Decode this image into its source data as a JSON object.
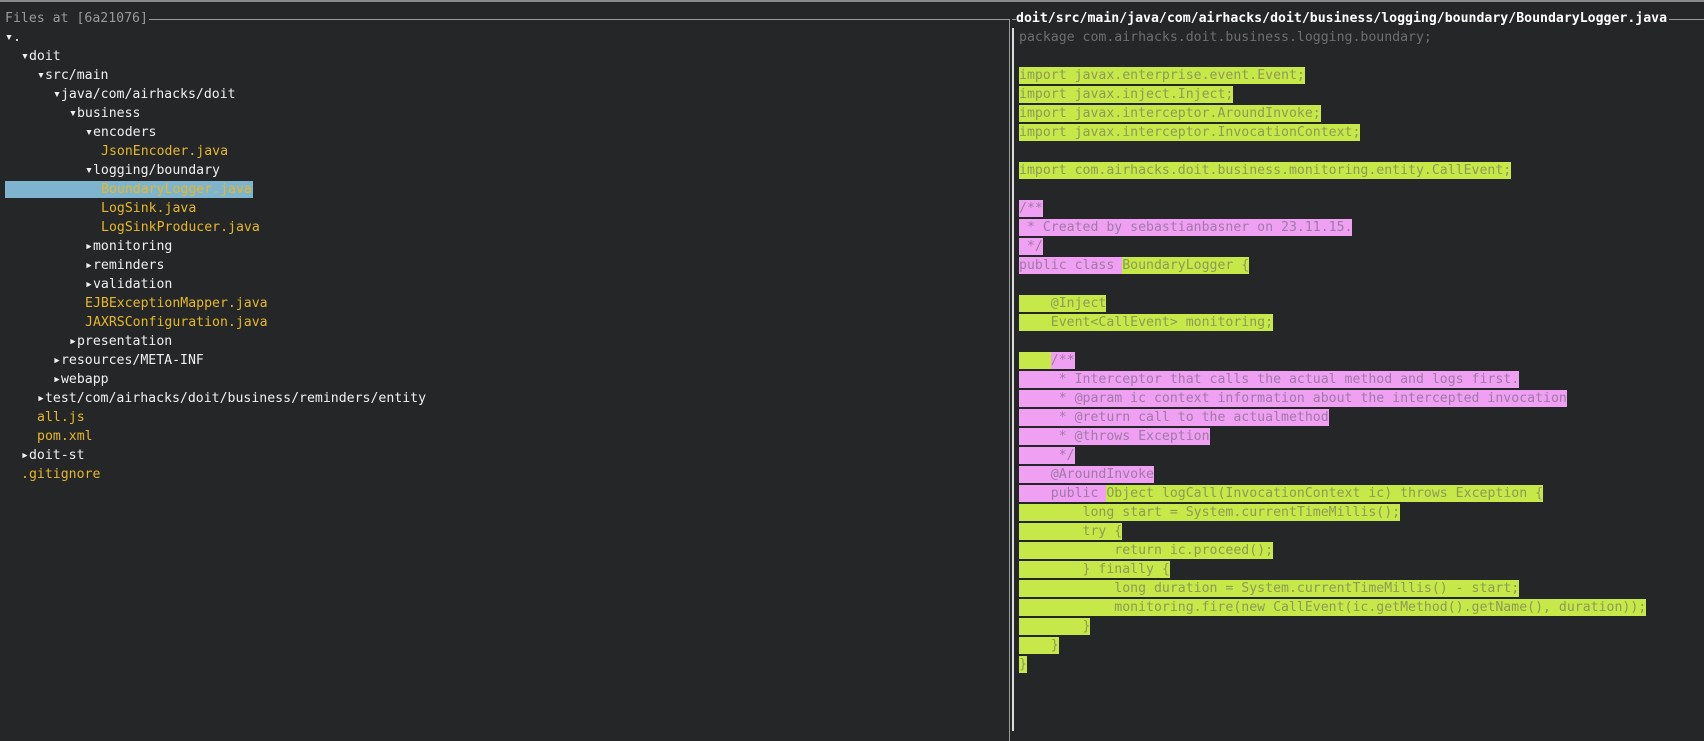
{
  "left_pane": {
    "title": "Files at [6a21076]",
    "tree": [
      {
        "label": "▾.",
        "kind": "dir",
        "depth": 0
      },
      {
        "label": "▾doit",
        "kind": "dir",
        "depth": 1
      },
      {
        "label": "▾src/main",
        "kind": "dir",
        "depth": 2
      },
      {
        "label": "▾java/com/airhacks/doit",
        "kind": "dir",
        "depth": 3
      },
      {
        "label": "▾business",
        "kind": "dir",
        "depth": 4
      },
      {
        "label": "▾encoders",
        "kind": "dir",
        "depth": 5
      },
      {
        "label": "JsonEncoder.java",
        "kind": "file",
        "depth": 6
      },
      {
        "label": "▾logging/boundary",
        "kind": "dir",
        "depth": 5
      },
      {
        "label": "BoundaryLogger.java",
        "kind": "file",
        "depth": 6,
        "selected": true
      },
      {
        "label": "LogSink.java",
        "kind": "file",
        "depth": 6
      },
      {
        "label": "LogSinkProducer.java",
        "kind": "file",
        "depth": 6
      },
      {
        "label": "▸monitoring",
        "kind": "dir",
        "depth": 5
      },
      {
        "label": "▸reminders",
        "kind": "dir",
        "depth": 5
      },
      {
        "label": "▸validation",
        "kind": "dir",
        "depth": 5
      },
      {
        "label": "EJBExceptionMapper.java",
        "kind": "file",
        "depth": 5
      },
      {
        "label": "JAXRSConfiguration.java",
        "kind": "file",
        "depth": 5
      },
      {
        "label": "▸presentation",
        "kind": "dir",
        "depth": 4
      },
      {
        "label": "▸resources/META-INF",
        "kind": "dir",
        "depth": 3
      },
      {
        "label": "▸webapp",
        "kind": "dir",
        "depth": 3
      },
      {
        "label": "▸test/com/airhacks/doit/business/reminders/entity",
        "kind": "dir",
        "depth": 2
      },
      {
        "label": "all.js",
        "kind": "file",
        "depth": 2
      },
      {
        "label": "pom.xml",
        "kind": "file",
        "depth": 2
      },
      {
        "label": "▸doit-st",
        "kind": "dir",
        "depth": 1
      },
      {
        "label": ".gitignore",
        "kind": "file",
        "depth": 1
      }
    ]
  },
  "right_pane": {
    "title": "doit/src/main/java/com/airhacks/doit/business/logging/boundary/BoundaryLogger.java",
    "lines": [
      [
        {
          "t": "package com.airhacks.doit.business.logging.boundary;",
          "c": "gray"
        }
      ],
      [],
      [
        {
          "t": "import ",
          "c": "g"
        },
        {
          "t": "javax.enterprise.event.Event;",
          "c": "g"
        }
      ],
      [
        {
          "t": "import javax.inject.Inject;",
          "c": "g"
        }
      ],
      [
        {
          "t": "import javax.interceptor.AroundInvoke;",
          "c": "g"
        }
      ],
      [
        {
          "t": "import javax.interceptor.InvocationContext;",
          "c": "g"
        }
      ],
      [],
      [
        {
          "t": "import com.airhacks.doit.business.monitoring.entity.CallEvent;",
          "c": "g"
        }
      ],
      [],
      [
        {
          "t": "/**",
          "c": "p"
        }
      ],
      [
        {
          "t": " * Created by sebastianbasner on 23.11.15.",
          "c": "p"
        }
      ],
      [
        {
          "t": " */",
          "c": "p"
        }
      ],
      [
        {
          "t": "public class ",
          "c": "p"
        },
        {
          "t": "BoundaryLogger {",
          "c": "g"
        }
      ],
      [],
      [
        {
          "t": "    @Inject",
          "c": "g"
        }
      ],
      [
        {
          "t": "    Event<CallEvent> monitoring;",
          "c": "g"
        }
      ],
      [],
      [
        {
          "t": "    ",
          "c": "g"
        },
        {
          "t": "/**",
          "c": "p"
        }
      ],
      [
        {
          "t": "     * Interceptor that calls the actual method and logs first.",
          "c": "p"
        }
      ],
      [
        {
          "t": "     * @param ic context information about the intercepted invocation",
          "c": "p"
        }
      ],
      [
        {
          "t": "     * @return call to the actualmethod",
          "c": "p"
        }
      ],
      [
        {
          "t": "     * @throws Exception",
          "c": "p"
        }
      ],
      [
        {
          "t": "     */",
          "c": "p"
        }
      ],
      [
        {
          "t": "    @AroundInvoke",
          "c": "p"
        }
      ],
      [
        {
          "t": "    public ",
          "c": "p"
        },
        {
          "t": "Object logCall(InvocationContext ic) throws Exception {",
          "c": "g"
        }
      ],
      [
        {
          "t": "        long start = System.currentTimeMillis();",
          "c": "g"
        }
      ],
      [
        {
          "t": "        try {",
          "c": "g"
        }
      ],
      [
        {
          "t": "            return ic.proceed();",
          "c": "g"
        }
      ],
      [
        {
          "t": "        } finally {",
          "c": "g"
        }
      ],
      [
        {
          "t": "            long duration = System.currentTimeMillis() - start;",
          "c": "g"
        }
      ],
      [
        {
          "t": "            monitoring.fire(new CallEvent(ic.getMethod().getName(), duration));",
          "c": "g"
        }
      ],
      [
        {
          "t": "        }",
          "c": "g"
        }
      ],
      [
        {
          "t": "    }",
          "c": "g"
        }
      ],
      [
        {
          "t": "}",
          "c": "g"
        }
      ],
      [],
      [],
      []
    ]
  },
  "colors": {
    "background": "#252628",
    "file": "#e5b829",
    "selection": "#7fb4cf",
    "added_green": "#c7e849",
    "added_pink": "#f0a0f3"
  }
}
